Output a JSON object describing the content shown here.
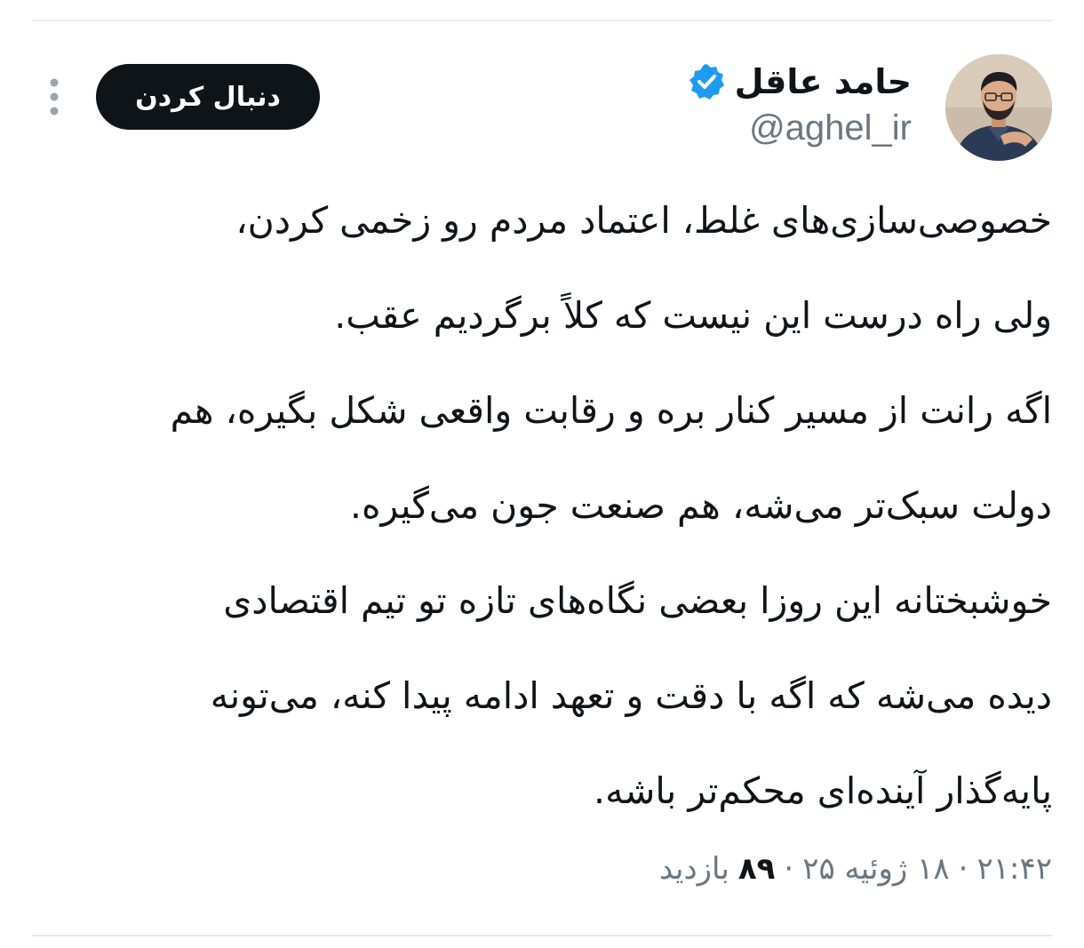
{
  "header": {
    "display_name": "حامد عاقل",
    "handle": "@aghel_ir",
    "follow_label": "دنبال کردن"
  },
  "icons": {
    "verified": "verified-badge-icon",
    "more": "more-vertical-icon",
    "avatar": "profile-photo"
  },
  "colors": {
    "verified_blue": "#1d9bf0",
    "follow_button_bg": "#0f1419",
    "secondary_text": "#6b7780"
  },
  "tweet": {
    "lines": [
      "خصوصی‌سازی‌های غلط، اعتماد مردم رو زخمی کردن،",
      "ولی راه درست این نیست که کلاً برگردیم عقب.",
      "اگه رانت از مسیر کنار بره و رقابت واقعی شکل بگیره، هم",
      "دولت سبک‌تر می‌شه، هم صنعت جون می‌گیره.",
      "خوشبختانه این روزا بعضی نگاه‌های تازه تو تیم اقتصادی",
      "دیده می‌شه که اگه با دقت و تعهد ادامه پیدا کنه، می‌تونه",
      "پایه‌گذار آینده‌ای محکم‌تر باشه."
    ]
  },
  "meta": {
    "time": "۲۱:۴۲",
    "separator": "·",
    "date": "۱۸ ژوئیه ۲۵",
    "views_count": "۸۹",
    "views_label": "بازدید"
  }
}
